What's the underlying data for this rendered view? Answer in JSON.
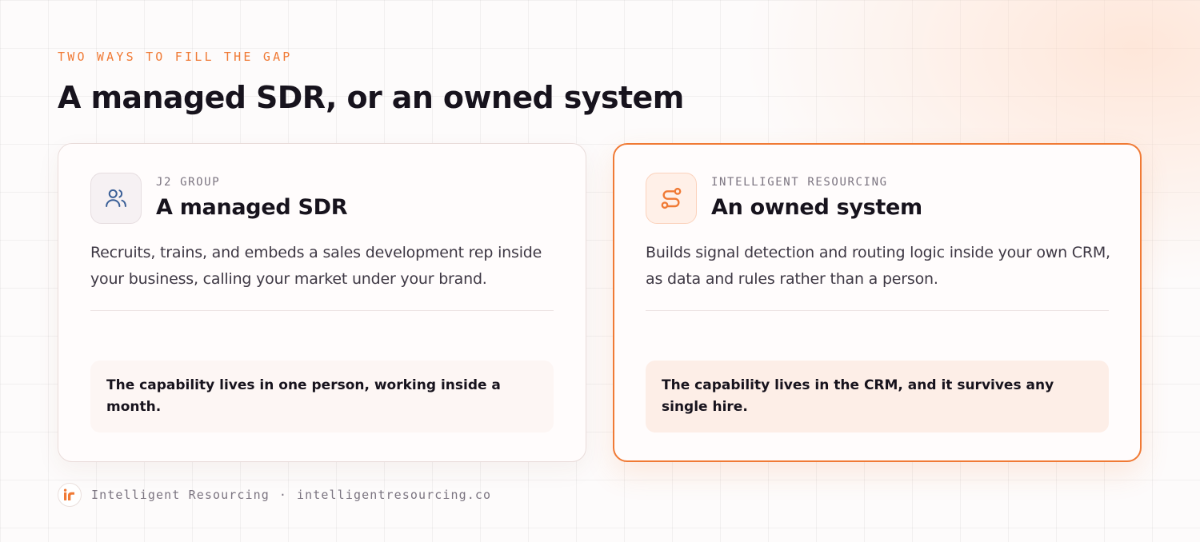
{
  "header": {
    "eyebrow": "TWO WAYS TO FILL THE GAP",
    "title": "A managed SDR, or an owned system"
  },
  "cards": [
    {
      "kicker": "J2 GROUP",
      "title": "A managed SDR",
      "description": "Recruits, trains, and embeds a sales development rep inside your business, calling your market under your brand.",
      "callout": "The capability lives in one person, working inside a month.",
      "icon": "users-icon",
      "highlighted": false
    },
    {
      "kicker": "INTELLIGENT RESOURCING",
      "title": "An owned system",
      "description": "Builds signal detection and routing logic inside your own CRM, as data and rules rather than a person.",
      "callout": "The capability lives in the CRM, and it survives any single hire.",
      "icon": "route-icon",
      "highlighted": true
    }
  ],
  "footer": {
    "brand": "Intelligent Resourcing",
    "separator": "·",
    "url": "intelligentresourcing.co",
    "logo": "ir-logo-icon"
  },
  "colors": {
    "accent": "#f07a35",
    "icon_blue": "#3a5f97",
    "text": "#17131d",
    "muted": "#7b7480"
  }
}
